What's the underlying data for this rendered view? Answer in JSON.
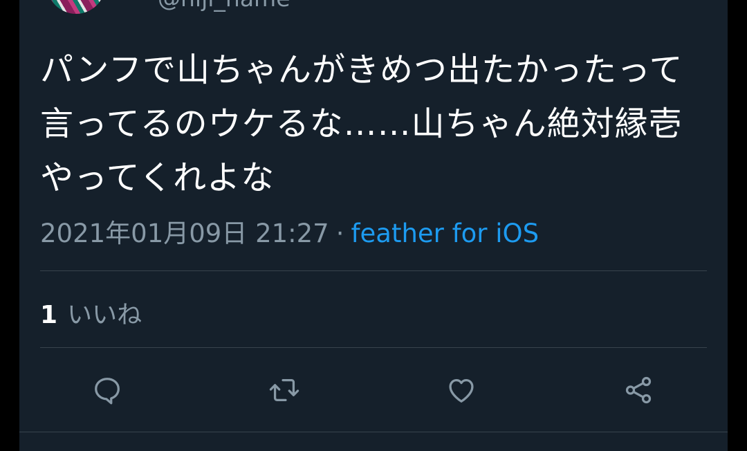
{
  "tweet": {
    "handle": "@niji_hame",
    "text": "パンフで山ちゃんがきめつ出たかったって言ってるのウケるな……山ちゃん絶対縁壱やってくれよな",
    "timestamp": "2021年01月09日 21:27",
    "separator": "·",
    "source": "feather for iOS",
    "likes_count": "1",
    "likes_label": "いいね"
  },
  "actions": {
    "reply": "reply-icon",
    "retweet": "retweet-icon",
    "like": "heart-icon",
    "share": "share-icon"
  },
  "colors": {
    "background": "#15202b",
    "text": "#ffffff",
    "secondary": "#8899a6",
    "link": "#1d9bf0",
    "divider": "#38444d"
  }
}
